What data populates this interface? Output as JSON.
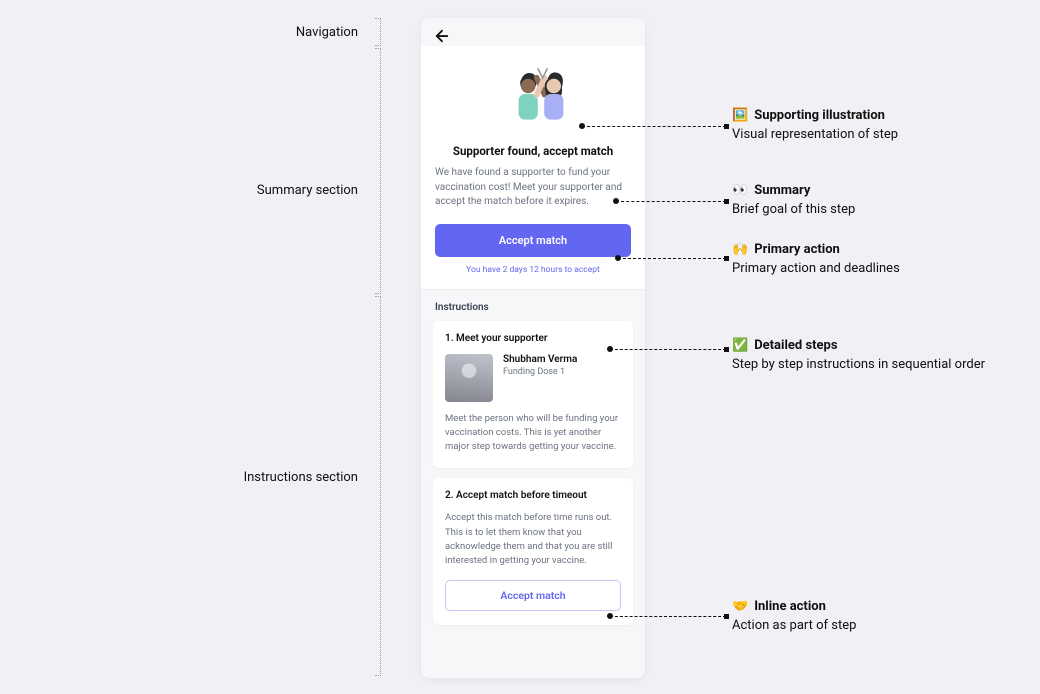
{
  "sections": {
    "navigation": "Navigation",
    "summary": "Summary section",
    "instructions": "Instructions section"
  },
  "screen": {
    "title": "Supporter found, accept match",
    "description": "We have found a supporter to fund your vaccination cost! Meet your supporter and accept the match before it expires.",
    "primary_action": "Accept match",
    "deadline": "You have 2 days 12 hours to accept",
    "instructions_heading": "Instructions",
    "steps": [
      {
        "title": "1. Meet your supporter",
        "supporter_name": "Shubham Verma",
        "supporter_sub": "Funding Dose 1",
        "body": "Meet the person who will be funding your vaccination costs. This is yet another major step towards getting your vaccine."
      },
      {
        "title": "2. Accept match before timeout",
        "body": "Accept this match before time runs out. This is to let them know that you acknowledge them and that you are still interested in getting your vaccine.",
        "inline_action": "Accept match"
      }
    ]
  },
  "callouts": {
    "illustration": {
      "emoji": "🖼️",
      "title": "Supporting illustration",
      "desc": "Visual representation of step"
    },
    "summary": {
      "emoji": "👀",
      "title": "Summary",
      "desc": "Brief goal of this step"
    },
    "primary": {
      "emoji": "🙌",
      "title": "Primary action",
      "desc": "Primary action and deadlines"
    },
    "steps": {
      "emoji": "✅",
      "title": "Detailed steps",
      "desc": "Step by step instructions in sequential order"
    },
    "inline": {
      "emoji": "🤝",
      "title": "Inline action",
      "desc": "Action as part of step"
    }
  }
}
